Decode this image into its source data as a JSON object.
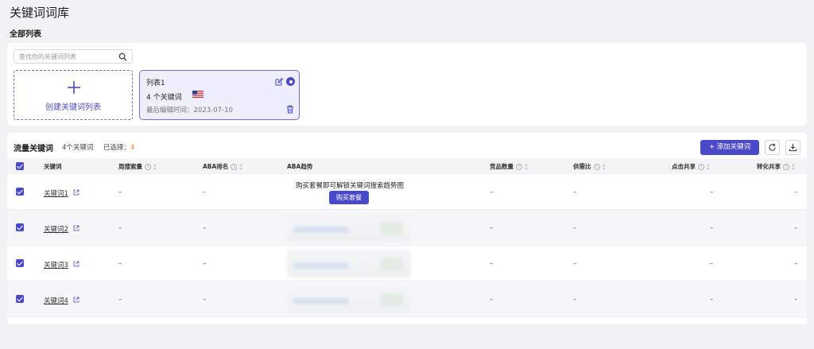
{
  "page": {
    "title": "关键词词库",
    "subtitle": "全部列表"
  },
  "search": {
    "placeholder": "查找你的关键词列表",
    "value": ""
  },
  "create_card": {
    "label": "创建关键词列表"
  },
  "list_card": {
    "name": "列表1",
    "count": "4 个关键词",
    "country_flag": "us-flag-icon",
    "last_edited": "最后编辑时间：2023-07-10"
  },
  "main": {
    "title": "流量关键词",
    "count": "4个关键词",
    "selected_label": "已选择：",
    "selected_count": "4",
    "add_button": "+ 添加关键词"
  },
  "table": {
    "headers": {
      "keyword": "关键词",
      "weekly_search": "周搜索量",
      "aba_rank": "ABA排名",
      "aba_trend": "ABA趋势",
      "competitors": "竞品数量",
      "supply_demand": "供需比",
      "click_share": "点击共享",
      "conversion_share": "转化共享"
    },
    "rows": [
      {
        "keyword": "关键词1",
        "weekly_search": "–",
        "aba_rank": "–",
        "competitors": "–",
        "supply_demand": "–",
        "click_share": "–",
        "conversion_share": "–"
      },
      {
        "keyword": "关键词2",
        "weekly_search": "–",
        "aba_rank": "–",
        "competitors": "–",
        "supply_demand": "–",
        "click_share": "–",
        "conversion_share": "–"
      },
      {
        "keyword": "关键词3",
        "weekly_search": "–",
        "aba_rank": "–",
        "competitors": "–",
        "supply_demand": "–",
        "click_share": "–",
        "conversion_share": "–"
      },
      {
        "keyword": "关键词4",
        "weekly_search": "–",
        "aba_rank": "–",
        "competitors": "–",
        "supply_demand": "–",
        "click_share": "–",
        "conversion_share": "–"
      }
    ],
    "unlock_message": "购买套餐即可解锁关键词搜索趋势图",
    "buy_button": "购买套餐"
  },
  "colors": {
    "accent": "#4a49c9",
    "highlight": "#ef7d22",
    "card_selected_bg": "#eeeefc"
  }
}
